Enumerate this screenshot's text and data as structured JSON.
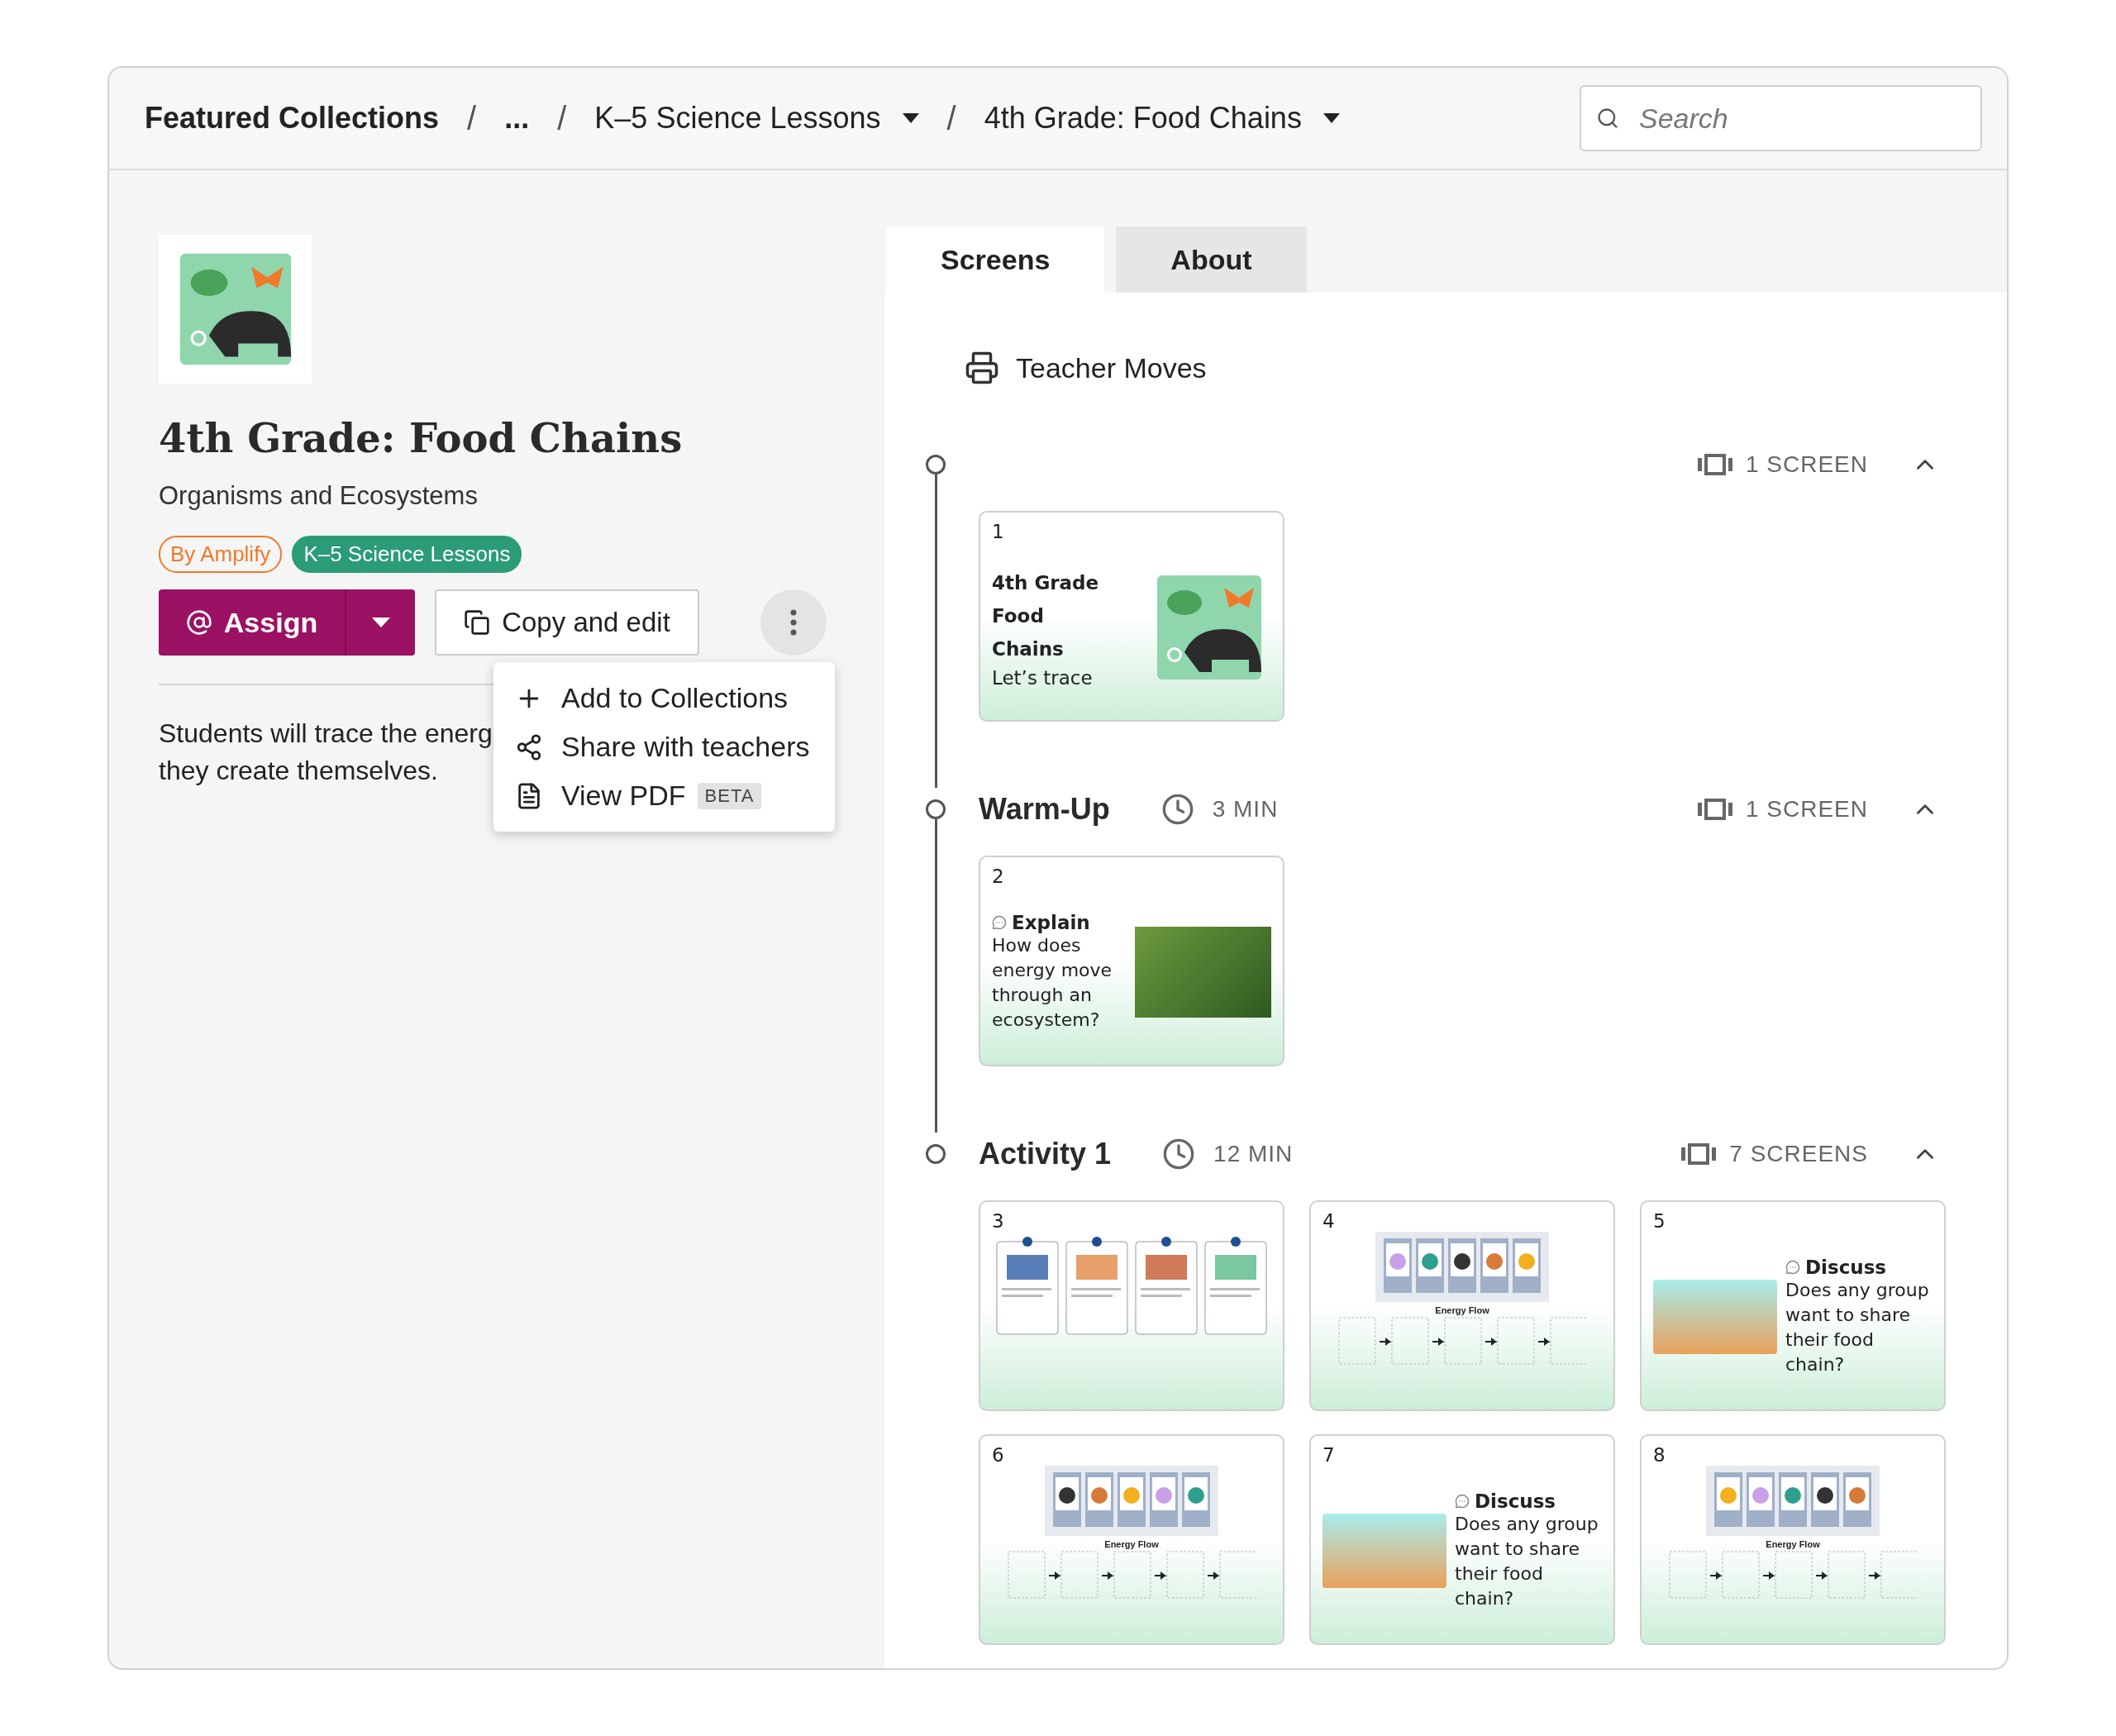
{
  "breadcrumb": [
    {
      "label": "Featured Collections",
      "kind": "root"
    },
    {
      "separator": "/",
      "label": "...",
      "kind": "ellipsis"
    },
    {
      "separator": "/",
      "label": "K–5 Science Lessons",
      "kind": "link",
      "dropdown": true
    },
    {
      "separator": "/",
      "label": "4th Grade: Food Chains",
      "kind": "link",
      "dropdown": true
    }
  ],
  "search": {
    "placeholder": "Search"
  },
  "lesson": {
    "title": "4th Grade: Food Chains",
    "subtitle": "Organisms and Ecosystems",
    "tags": [
      {
        "label": "By Amplify",
        "kind": "outline",
        "color": "#f0782d"
      },
      {
        "label": "K–5 Science Lessons",
        "kind": "filled",
        "color": "#2b9b78"
      }
    ],
    "assign_button": "Assign",
    "copy_button": "Copy and edit",
    "description": [
      "Students will trace the energ",
      "they create themselves."
    ]
  },
  "menu": {
    "open": true,
    "items": [
      {
        "label": "Add to Collections"
      },
      {
        "label": "Share with teachers"
      },
      {
        "label": "View PDF",
        "badge": "BETA"
      }
    ]
  },
  "tabs": [
    {
      "label": "Screens",
      "selected": true
    },
    {
      "label": "About",
      "selected": false
    }
  ],
  "teacher_moves": "Teacher Moves",
  "sections": [
    {
      "screens": "1 SCREEN",
      "expanded": true,
      "thumbnails": [
        {
          "number": "1",
          "kind": "title",
          "title": "4th Grade Food Chains",
          "subtitle": "Let’s trace"
        }
      ]
    },
    {
      "title": "Warm-Up",
      "duration": "3 MIN",
      "screens": "1 SCREEN",
      "expanded": true,
      "thumbnails": [
        {
          "number": "2",
          "kind": "prompt_photo",
          "label": "Explain",
          "text": "How does energy move through an ecosystem?"
        }
      ]
    },
    {
      "title": "Activity 1",
      "duration": "12 MIN",
      "screens": "7 SCREENS",
      "expanded": true,
      "thumbnails": [
        {
          "number": "3",
          "kind": "steps"
        },
        {
          "number": "4",
          "kind": "flow",
          "label": "Energy Flow"
        },
        {
          "number": "5",
          "kind": "prompt_illustration",
          "label": "Discuss",
          "text": "Does any group want to share their food chain?"
        },
        {
          "number": "6",
          "kind": "flow",
          "label": "Energy Flow"
        },
        {
          "number": "7",
          "kind": "prompt_illustration",
          "label": "Discuss",
          "text": "Does any group want to share their food chain?"
        },
        {
          "number": "8",
          "kind": "flow",
          "label": "Energy Flow"
        }
      ]
    }
  ]
}
